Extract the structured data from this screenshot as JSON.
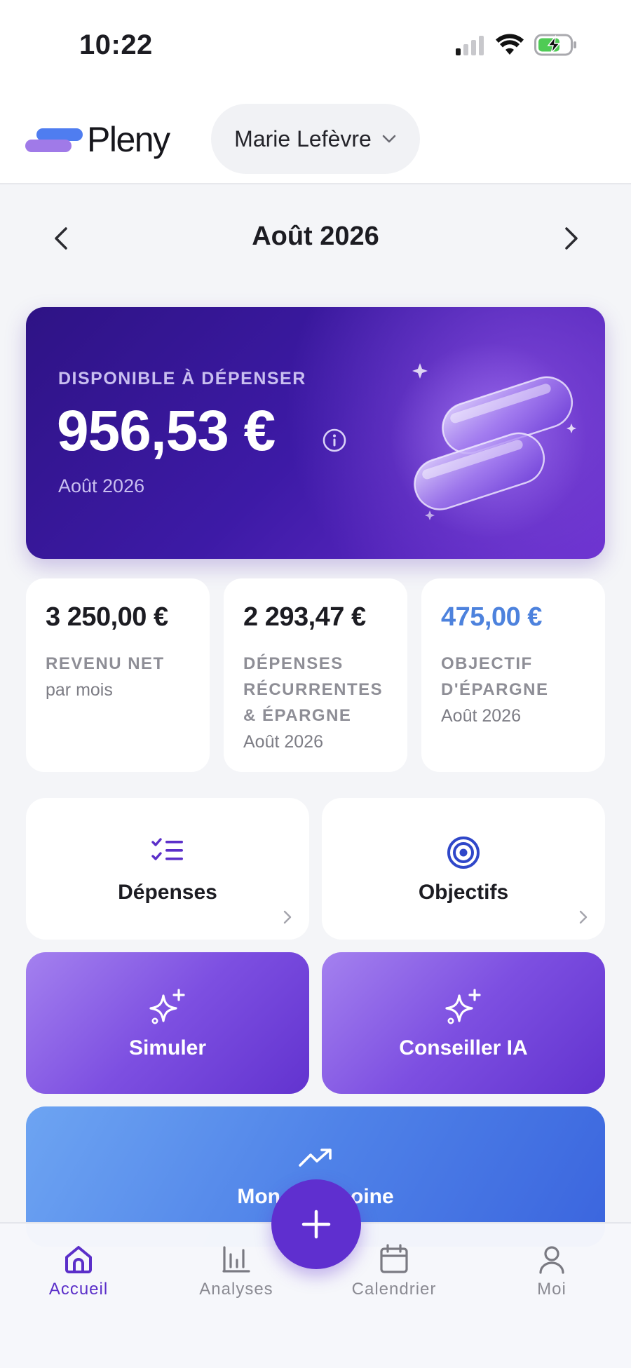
{
  "status_bar": {
    "time": "10:22",
    "icons": [
      "cellular-signal-icon",
      "wifi-icon",
      "battery-charging-icon"
    ]
  },
  "header": {
    "app_name": "Pleny",
    "user_name": "Marie Lefèvre"
  },
  "month_nav": {
    "title": "Août 2026"
  },
  "hero": {
    "label": "DISPONIBLE À DÉPENSER",
    "amount": "956,53 €",
    "period": "Août 2026"
  },
  "stats": [
    {
      "value": "3 250,00 €",
      "label": "REVENU NET",
      "sub": "par mois"
    },
    {
      "value": "2 293,47 €",
      "label": "DÉPENSES RÉCURRENTES & ÉPARGNE",
      "sub": "Août 2026"
    },
    {
      "value": "475,00 €",
      "label": "OBJECTIF D'ÉPARGNE",
      "sub": "Août 2026"
    }
  ],
  "tiles": {
    "depenses": "Dépenses",
    "objectifs": "Objectifs",
    "simuler": "Simuler",
    "conseiller": "Conseiller IA",
    "patrimoine": "Mon patrimoine"
  },
  "bottom_nav": {
    "items": [
      {
        "label": "Accueil",
        "icon": "home-icon",
        "active": true
      },
      {
        "label": "Analyses",
        "icon": "bar-chart-icon",
        "active": false
      },
      {
        "label": "Calendrier",
        "icon": "calendar-icon",
        "active": false
      },
      {
        "label": "Moi",
        "icon": "user-icon",
        "active": false
      }
    ],
    "fab_icon": "plus-icon"
  },
  "colors": {
    "accent": "#5f2fcf",
    "hero_dark": "#2e1385",
    "savings_blue": "#4d82dd",
    "logo_blue": "#4f7df0",
    "logo_purple": "#a07ae8"
  }
}
